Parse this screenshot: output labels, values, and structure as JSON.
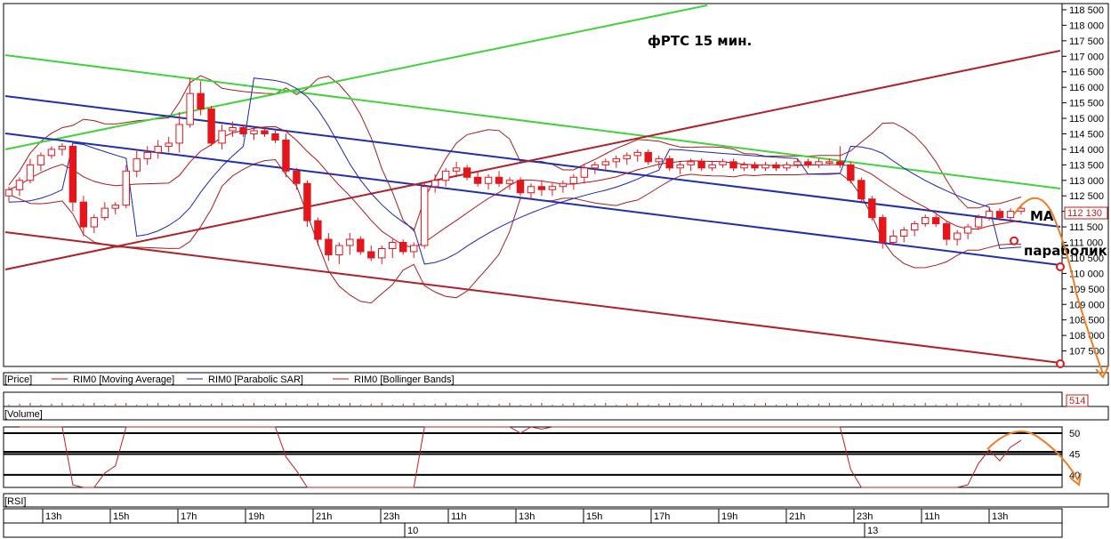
{
  "chart_data": {
    "type": "candlestick",
    "title": "фРТС   15 мин.",
    "price_axis": {
      "min": 107000,
      "max": 118700,
      "ticks": [
        "118 500",
        "118 000",
        "117 500",
        "117 000",
        "116 500",
        "116 000",
        "115 500",
        "115 000",
        "114 500",
        "114 000",
        "113 500",
        "113 000",
        "112 500",
        "112 000",
        "111 500",
        "111 000",
        "110 500",
        "110 000",
        "109 500",
        "109 000",
        "108 500",
        "108 000",
        "107 500"
      ],
      "tick_values": [
        118500,
        118000,
        117500,
        117000,
        116500,
        116000,
        115500,
        115000,
        114500,
        114000,
        113500,
        113000,
        112500,
        112000,
        111500,
        111000,
        110500,
        110000,
        109500,
        109000,
        108500,
        108000,
        107500
      ],
      "last_price": "112 130",
      "last_price_value": 112130
    },
    "time_axis": {
      "hour_labels": [
        "13h",
        "15h",
        "17h",
        "19h",
        "21h",
        "23h",
        "11h",
        "13h",
        "15h",
        "17h",
        "19h",
        "21h",
        "23h",
        "11h",
        "13h"
      ],
      "day_labels": [
        "10",
        "13"
      ]
    },
    "candles": [
      [
        112500,
        112800,
        112300,
        112700
      ],
      [
        112700,
        113100,
        112500,
        113000
      ],
      [
        113000,
        113700,
        112900,
        113500
      ],
      [
        113500,
        113900,
        113300,
        113800
      ],
      [
        113800,
        114100,
        113700,
        114000
      ],
      [
        114000,
        114200,
        113800,
        114100
      ],
      [
        114100,
        113800,
        112000,
        112300
      ],
      [
        112300,
        112500,
        111200,
        111500
      ],
      [
        111500,
        111900,
        111300,
        111800
      ],
      [
        111800,
        112300,
        111700,
        112100
      ],
      [
        112100,
        112300,
        111900,
        112200
      ],
      [
        112200,
        113500,
        112100,
        113300
      ],
      [
        113300,
        114000,
        113100,
        113700
      ],
      [
        113700,
        114100,
        113500,
        113900
      ],
      [
        113900,
        114300,
        113700,
        114100
      ],
      [
        114100,
        114400,
        113900,
        114200
      ],
      [
        114200,
        115200,
        113900,
        114800
      ],
      [
        114800,
        116300,
        114700,
        115800
      ],
      [
        115800,
        116200,
        115100,
        115300
      ],
      [
        115300,
        115400,
        114100,
        114200
      ],
      [
        114200,
        114800,
        114000,
        114600
      ],
      [
        114600,
        114900,
        114400,
        114700
      ],
      [
        114700,
        114800,
        114400,
        114500
      ],
      [
        114500,
        114700,
        114300,
        114600
      ],
      [
        114600,
        114700,
        114400,
        114500
      ],
      [
        114500,
        114600,
        114200,
        114300
      ],
      [
        114300,
        114500,
        113100,
        113300
      ],
      [
        113300,
        113400,
        112700,
        112900
      ],
      [
        112900,
        113000,
        111500,
        111700
      ],
      [
        111700,
        111800,
        110900,
        111100
      ],
      [
        111100,
        111300,
        110400,
        110600
      ],
      [
        110600,
        111000,
        110300,
        110900
      ],
      [
        110900,
        111300,
        110600,
        111100
      ],
      [
        111100,
        111200,
        110600,
        110700
      ],
      [
        110700,
        110900,
        110400,
        110500
      ],
      [
        110500,
        110900,
        110300,
        110800
      ],
      [
        110800,
        111100,
        110500,
        111000
      ],
      [
        111000,
        111100,
        110600,
        110700
      ],
      [
        110700,
        111000,
        110500,
        110900
      ],
      [
        110900,
        112900,
        110800,
        112800
      ],
      [
        112800,
        113200,
        112600,
        113000
      ],
      [
        113000,
        113400,
        112800,
        113300
      ],
      [
        113300,
        113600,
        113100,
        113400
      ],
      [
        113400,
        113500,
        113000,
        113100
      ],
      [
        113100,
        113300,
        112800,
        112900
      ],
      [
        112900,
        113200,
        112700,
        113100
      ],
      [
        113100,
        113300,
        112800,
        112900
      ],
      [
        112900,
        113100,
        112700,
        113000
      ],
      [
        113000,
        113100,
        112500,
        112600
      ],
      [
        112600,
        112900,
        112400,
        112800
      ],
      [
        112800,
        113000,
        112500,
        112700
      ],
      [
        112700,
        112900,
        112500,
        112800
      ],
      [
        112800,
        113000,
        112600,
        112900
      ],
      [
        112900,
        113200,
        112700,
        113100
      ],
      [
        113100,
        113500,
        112900,
        113400
      ],
      [
        113400,
        113600,
        113200,
        113500
      ],
      [
        113500,
        113700,
        113300,
        113600
      ],
      [
        113600,
        113800,
        113400,
        113700
      ],
      [
        113700,
        113900,
        113500,
        113800
      ],
      [
        113800,
        114000,
        113600,
        113900
      ],
      [
        113900,
        114000,
        113500,
        113600
      ],
      [
        113600,
        113800,
        113400,
        113700
      ],
      [
        113700,
        113800,
        113300,
        113400
      ],
      [
        113400,
        113600,
        113200,
        113500
      ],
      [
        113500,
        113700,
        113300,
        113600
      ],
      [
        113600,
        113700,
        113300,
        113400
      ],
      [
        113400,
        113600,
        113300,
        113500
      ],
      [
        113500,
        113700,
        113400,
        113600
      ],
      [
        113600,
        113700,
        113300,
        113400
      ],
      [
        113400,
        113600,
        113300,
        113500
      ],
      [
        113500,
        113600,
        113300,
        113400
      ],
      [
        113400,
        113600,
        113300,
        113500
      ],
      [
        113500,
        113600,
        113300,
        113400
      ],
      [
        113400,
        113600,
        113300,
        113500
      ],
      [
        113500,
        113700,
        113400,
        113600
      ],
      [
        113600,
        113700,
        113400,
        113500
      ],
      [
        113500,
        113700,
        113400,
        113600
      ],
      [
        113600,
        113700,
        113500,
        113600
      ],
      [
        113600,
        114100,
        113400,
        113500
      ],
      [
        113500,
        113600,
        112900,
        113000
      ],
      [
        113000,
        113100,
        112300,
        112400
      ],
      [
        112400,
        112500,
        111700,
        111800
      ],
      [
        111800,
        111900,
        110800,
        111000
      ],
      [
        111000,
        111400,
        110900,
        111200
      ],
      [
        111200,
        111500,
        111000,
        111400
      ],
      [
        111400,
        111700,
        111200,
        111600
      ],
      [
        111600,
        111900,
        111500,
        111800
      ],
      [
        111800,
        111900,
        111500,
        111600
      ],
      [
        111600,
        111700,
        110900,
        111100
      ],
      [
        111100,
        111400,
        110900,
        111300
      ],
      [
        111300,
        111600,
        111100,
        111500
      ],
      [
        111500,
        111900,
        111400,
        111800
      ],
      [
        111800,
        112100,
        111700,
        112000
      ],
      [
        112000,
        112100,
        111700,
        111800
      ],
      [
        111800,
        112100,
        111700,
        112000
      ],
      [
        112000,
        112200,
        111900,
        112100
      ]
    ],
    "levels": {
      "ma_last": 111950,
      "sar_last": 111050,
      "upper_projection": 112250
    },
    "annotations": {
      "ma_label": "МА",
      "sar_label": "параболик"
    },
    "legend": {
      "price_label": "[Price]",
      "ma_label": "RIM0 [Moving Average]",
      "sar_label": "RIM0 [Parabolic SAR]",
      "bb_label": "RIM0 [Bollinger Bands]"
    },
    "volume": {
      "label": "[Volume]",
      "last": "514"
    },
    "rsi": {
      "label": "[RSI]",
      "ticks": [
        "50",
        "45",
        "40"
      ],
      "tick_values": [
        50,
        45,
        40
      ],
      "min": 37,
      "max": 51.5
    },
    "colors": {
      "bear": "#e4161c",
      "bull": "#ffffff",
      "candle_outline": "#e4161c",
      "ma": "#b3131b",
      "sar": "#1a26b5",
      "bollinger": "#a81c1c",
      "green_line": "#3fd43a",
      "blue_line": "#1f2fb0",
      "brown_line": "#b3202a",
      "forecast": "#ef7d24",
      "rsi_line": "#c21f1f"
    }
  }
}
